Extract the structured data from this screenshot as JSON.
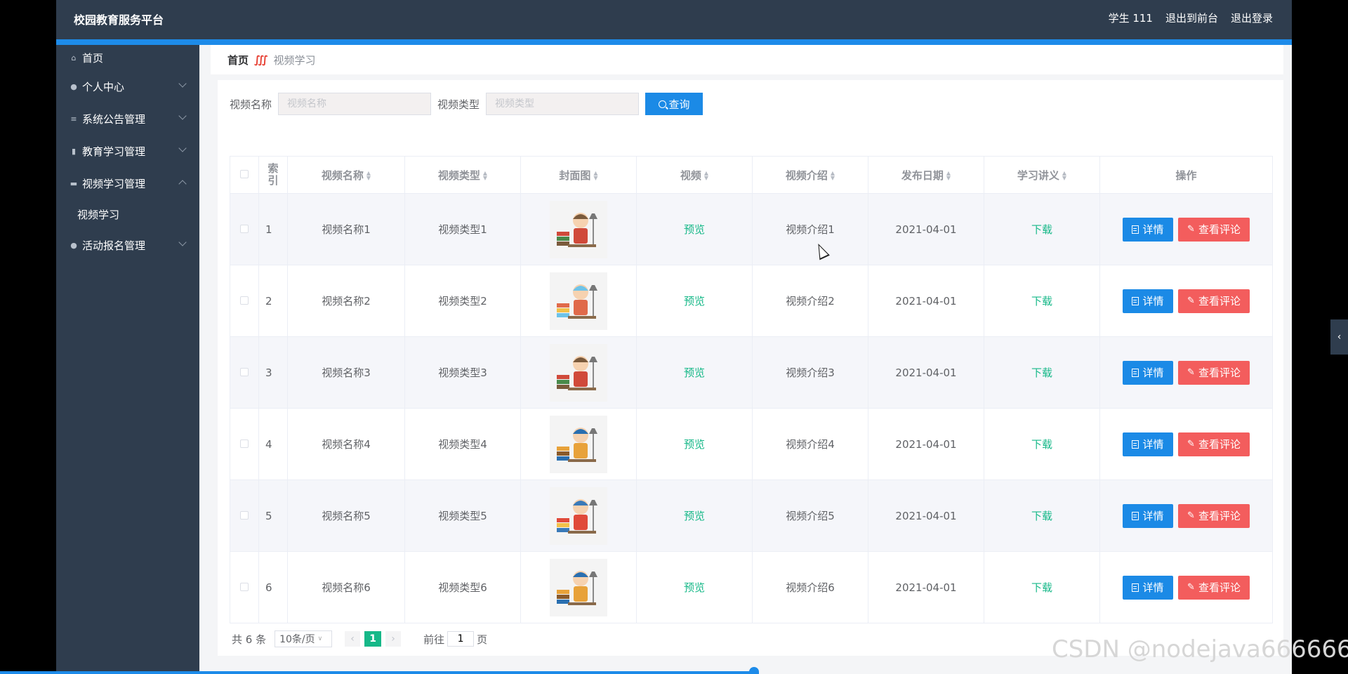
{
  "app": {
    "title": "校园教育服务平台"
  },
  "topbar": {
    "user": "学生 111",
    "back_front": "退出到前台",
    "logout": "退出登录"
  },
  "sidebar": {
    "items": [
      {
        "label": "首页",
        "icon": "home-icon"
      },
      {
        "label": "个人中心",
        "icon": "user-icon"
      },
      {
        "label": "系统公告管理",
        "icon": "list-icon"
      },
      {
        "label": "教育学习管理",
        "icon": "chart-icon"
      },
      {
        "label": "视频学习管理",
        "icon": "chat-icon"
      },
      {
        "label": "活动报名管理",
        "icon": "user-icon"
      }
    ],
    "sub_items": [
      {
        "label": "视频学习"
      }
    ]
  },
  "breadcrumb": {
    "home": "首页",
    "separator": "∭",
    "current": "视频学习"
  },
  "search": {
    "name_label": "视频名称",
    "name_placeholder": "视频名称",
    "type_label": "视频类型",
    "type_placeholder": "视频类型",
    "button": "查询"
  },
  "table": {
    "headers": [
      "索引",
      "视频名称",
      "视频类型",
      "封面图",
      "视频",
      "视频介绍",
      "发布日期",
      "学习讲义",
      "操作"
    ],
    "rows": [
      {
        "index": "1",
        "name": "视频名称1",
        "type": "视频类型1",
        "video": "预览",
        "intro": "视频介绍1",
        "date": "2021-04-01",
        "handout": "下载",
        "detail": "详情",
        "comment": "查看评论"
      },
      {
        "index": "2",
        "name": "视频名称2",
        "type": "视频类型2",
        "video": "预览",
        "intro": "视频介绍2",
        "date": "2021-04-01",
        "handout": "下载",
        "detail": "详情",
        "comment": "查看评论"
      },
      {
        "index": "3",
        "name": "视频名称3",
        "type": "视频类型3",
        "video": "预览",
        "intro": "视频介绍3",
        "date": "2021-04-01",
        "handout": "下载",
        "detail": "详情",
        "comment": "查看评论"
      },
      {
        "index": "4",
        "name": "视频名称4",
        "type": "视频类型4",
        "video": "预览",
        "intro": "视频介绍4",
        "date": "2021-04-01",
        "handout": "下载",
        "detail": "详情",
        "comment": "查看评论"
      },
      {
        "index": "5",
        "name": "视频名称5",
        "type": "视频类型5",
        "video": "预览",
        "intro": "视频介绍5",
        "date": "2021-04-01",
        "handout": "下载",
        "detail": "详情",
        "comment": "查看评论"
      },
      {
        "index": "6",
        "name": "视频名称6",
        "type": "视频类型6",
        "video": "预览",
        "intro": "视频介绍6",
        "date": "2021-04-01",
        "handout": "下载",
        "detail": "详情",
        "comment": "查看评论"
      }
    ]
  },
  "pagination": {
    "total": "共 6 条",
    "page_size": "10条/页",
    "current_page": "1",
    "goto_label": "前往",
    "goto_value": "1",
    "page_suffix": "页"
  },
  "watermark": "CSDN @nodejava666666",
  "colors": {
    "sidebar": "#2f3d4e",
    "accent_blue": "#1b8ae6",
    "danger": "#f35d5d",
    "green": "#16b888"
  }
}
